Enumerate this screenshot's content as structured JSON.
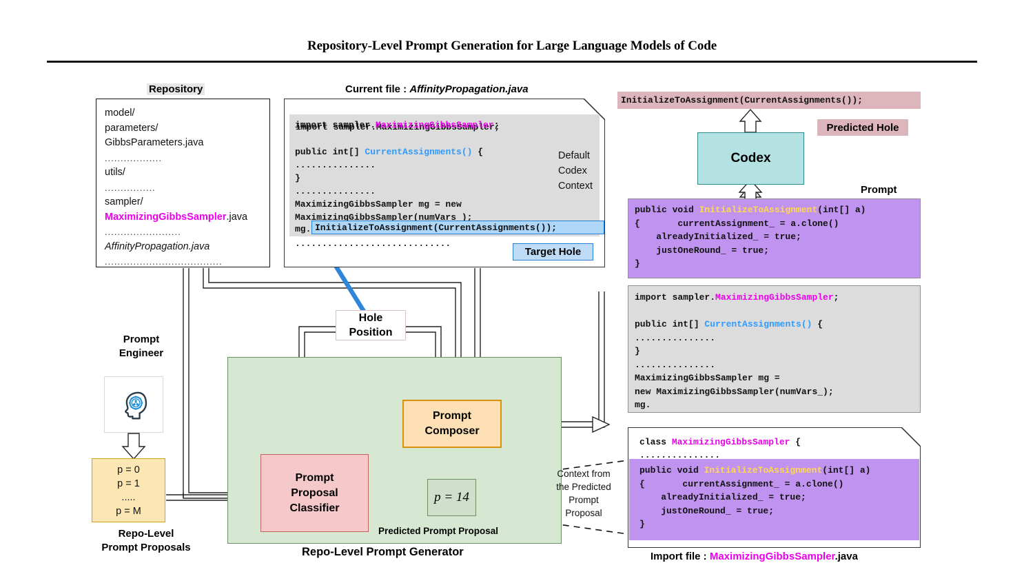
{
  "title": "Repository-Level Prompt Generation for Large Language Models of Code",
  "repository": {
    "label": "Repository",
    "items": [
      {
        "text": "model/",
        "style": "plain"
      },
      {
        "text": "parameters/",
        "style": "plain"
      },
      {
        "text": " GibbsParameters.java",
        "style": "plain"
      },
      {
        "text": "..................",
        "style": "dots"
      },
      {
        "text": "utils/",
        "style": "plain"
      },
      {
        "text": "................",
        "style": "dots"
      },
      {
        "text": "sampler/",
        "style": "plain"
      },
      {
        "text": "MaximizingGibbsSampler.java",
        "style": "magenta-prefix",
        "magenta": "MaximizingGibbsSampler",
        "rest": ".java"
      },
      {
        "text": "      ........................",
        "style": "dots"
      },
      {
        "text": "AffinityPropagation.java",
        "style": "italic"
      },
      {
        "text": ".....................................",
        "style": "dots"
      }
    ]
  },
  "current_file": {
    "label_prefix": "Current file : ",
    "label_file": "AffinityPropagation.java",
    "code_lines": [
      "import sampler.MaximizingGibbsSampler;",
      "",
      "public int[] CurrentAssignments() {",
      "...............",
      "}",
      "...............",
      "MaximizingGibbsSampler mg = new",
      "MaximizingGibbsSampler(numVars_);"
    ],
    "highlighted_prefix": "mg.",
    "highlighted_line": "InitializeToAssignment(CurrentAssignments());",
    "trailing_dots": ".............................",
    "context_note": "Default Codex Context",
    "context_note_lines": [
      "Default",
      "Codex",
      "Context"
    ],
    "target_hole_badge": "Target Hole"
  },
  "prediction": {
    "predicted_hole_code": "InitializeToAssignment(CurrentAssignments());",
    "predicted_hole_badge": "Predicted Hole",
    "model_name": "Codex",
    "prompt_label": "Prompt",
    "prompt_purple_lines": [
      "public void InitializeToAssignment(int[] a)",
      "{       currentAssignment_ = a.clone()",
      "    alreadyInitialized_ = true;",
      "    justOneRound_ = true;",
      "}"
    ],
    "prompt_gray_lines": [
      "import sampler.MaximizingGibbsSampler;",
      "",
      "public int[] CurrentAssignments() {",
      "...............",
      "}",
      "...............",
      "MaximizingGibbsSampler mg =",
      "new MaximizingGibbsSampler(numVars_);",
      "mg."
    ]
  },
  "import_file": {
    "header_line": "class MaximizingGibbsSampler {",
    "header_keyword": "class ",
    "header_class": "MaximizingGibbsSampler",
    "header_brace": " {",
    "dots_line": "...............",
    "purple_lines": [
      "public void InitializeToAssignment(int[] a)",
      "{       currentAssignment_ = a.clone()",
      "    alreadyInitialized_ = true;",
      "    justOneRound_ = true;",
      "}"
    ],
    "caption_prefix": "Import file : ",
    "caption_file_magenta": "MaximizingGibbsSampler",
    "caption_file_rest": ".java"
  },
  "prompt_engineer": {
    "label_lines": [
      "Prompt",
      "Engineer"
    ],
    "icon": "head-gear-icon",
    "proposals": [
      "p = 0",
      "p = 1",
      ".....",
      "p = M"
    ],
    "proposals_caption_lines": [
      "Repo-Level",
      "Prompt Proposals"
    ]
  },
  "generator": {
    "caption": "Repo-Level Prompt Generator",
    "classifier_lines": [
      "Prompt",
      "Proposal",
      "Classifier"
    ],
    "composer_lines": [
      "Prompt",
      "Composer"
    ],
    "predicted_proposal_value": "p = 14",
    "predicted_proposal_caption": "Predicted Prompt Proposal",
    "hole_position_lines": [
      "Hole",
      "Position"
    ],
    "context_note_lines": [
      "Context from",
      "the Predicted",
      "Prompt",
      "Proposal"
    ]
  },
  "colors": {
    "magenta": "#ec00ec",
    "blue_identifier": "#2f9bff",
    "yellow_identifier": "#ffd84d",
    "codex_fill": "#b4e2e2",
    "codex_border": "#2e8b8b",
    "predicted_pink": "#ddb5bd",
    "prompt_purple": "#c193f0",
    "gray_code": "#dcdcdc",
    "green_panel": "#d6e8d2",
    "classifier_pink": "#f5c9c9",
    "composer_orange": "#fcdfb5",
    "proposals_yellow": "#fce6b4",
    "target_hole_blue": "#bfdcf7",
    "arrow_blue": "#2f86d8"
  }
}
